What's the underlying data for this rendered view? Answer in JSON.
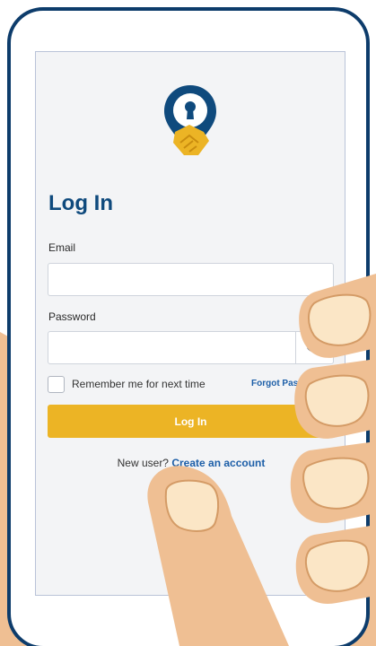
{
  "colors": {
    "frame": "#0d3c6b",
    "title": "#0f4a7d",
    "accent_button": "#ecb425",
    "link": "#1d5fa8",
    "skin": "#efbf93",
    "nail": "#fbe6c6"
  },
  "logo": {
    "icon": "keyhole-handshake-pin-icon"
  },
  "login": {
    "title": "Log In",
    "email_label": "Email",
    "email_value": "",
    "password_label": "Password",
    "password_value": "",
    "show_password_icon": "eye-icon",
    "remember_label": "Remember me for next time",
    "forgot_label": "Forgot Pas",
    "submit_label": "Log In",
    "new_user_text": "New user?",
    "create_account_label": "Create an account"
  }
}
